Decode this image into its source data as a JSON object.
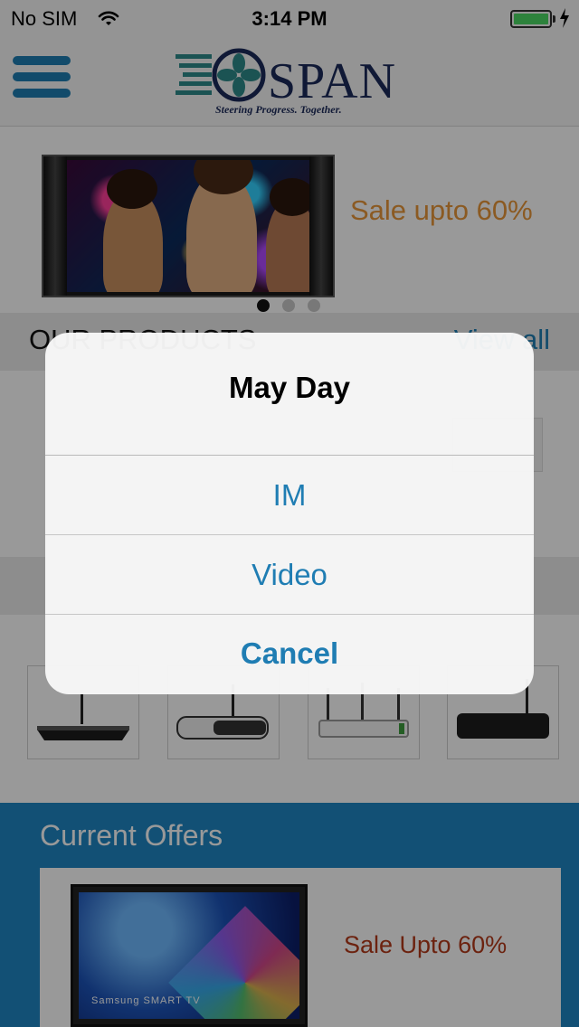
{
  "status_bar": {
    "carrier": "No SIM",
    "time": "3:14 PM",
    "battery_level": 1.0,
    "charging": true
  },
  "nav": {
    "menu_icon": "hamburger-icon",
    "logo": {
      "wordmark": "SPAN",
      "tagline": "Steering Progress. Together."
    }
  },
  "banner": {
    "sale_text": "Sale upto 60%",
    "page_count": 3,
    "active_page": 1
  },
  "products": {
    "title": "OUR PRODUCTS",
    "view_all": "View all"
  },
  "offers": {
    "title": "Current Offers",
    "card": {
      "tv_brand": "Samsung SMART TV",
      "sale_text": "Sale Upto 60%"
    }
  },
  "alert": {
    "title": "May Day",
    "buttons": [
      "IM",
      "Video",
      "Cancel"
    ]
  },
  "colors": {
    "accent_blue": "#1f7db3",
    "offers_background": "#1e86c4",
    "banner_sale_orange": "#e8963a",
    "offer_sale_red": "#b43a1a"
  }
}
